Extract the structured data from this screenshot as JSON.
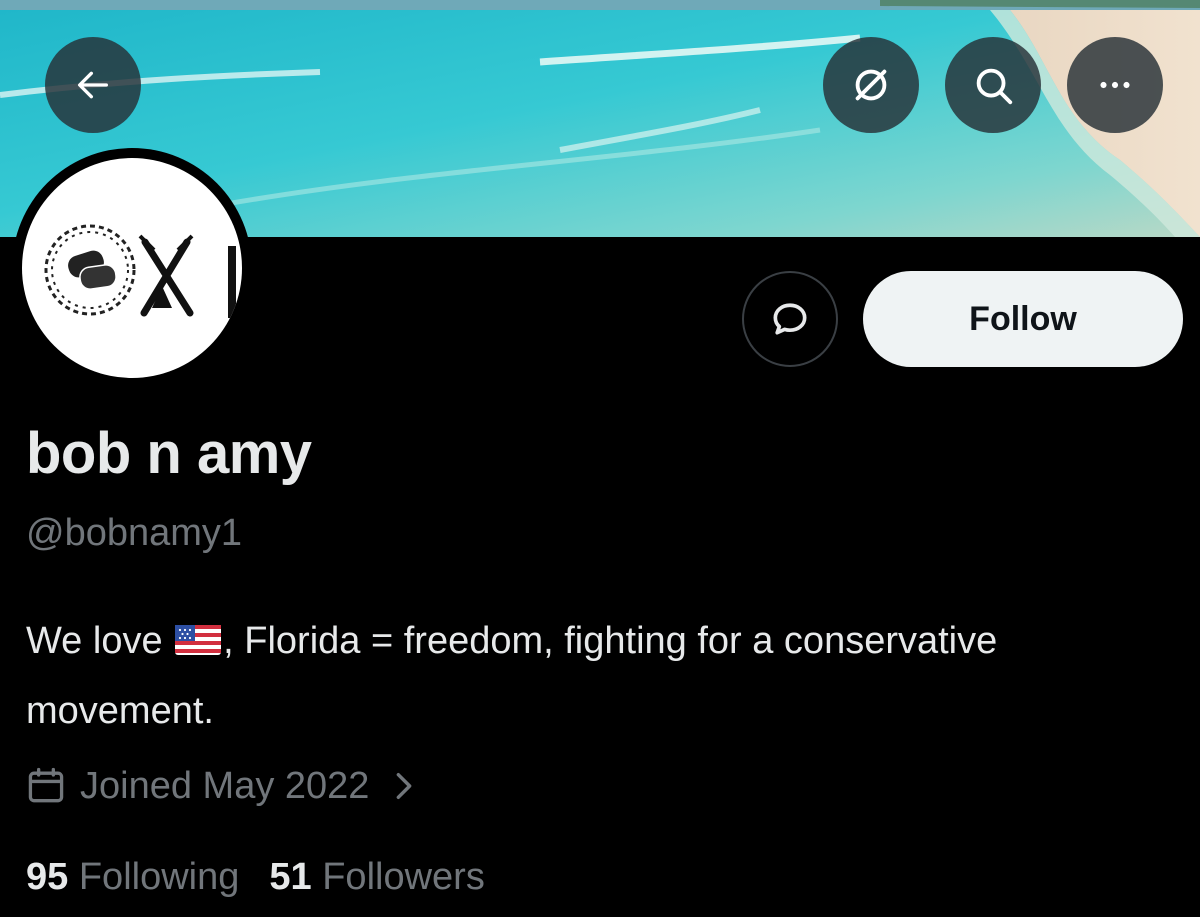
{
  "profile": {
    "display_name": "bob n amy",
    "handle": "@bobnamy1",
    "bio_part1": "We love",
    "bio_flag": "us-flag-emoji",
    "bio_part2": ", Florida = freedom, fighting for a conservative movement.",
    "joined": "Joined May 2022",
    "following_count": "95",
    "following_label": "Following",
    "followers_count": "51",
    "followers_label": "Followers"
  },
  "actions": {
    "follow_label": "Follow",
    "back_icon": "arrow-left-icon",
    "grok_icon": "slashed-circle-icon",
    "search_icon": "search-icon",
    "more_icon": "more-dots-icon",
    "message_icon": "message-bubble-icon"
  },
  "theme": {
    "background": "#000000",
    "primary_text": "#e7e9ea",
    "secondary_text": "#71767b",
    "follow_button_bg": "#eff3f4"
  }
}
